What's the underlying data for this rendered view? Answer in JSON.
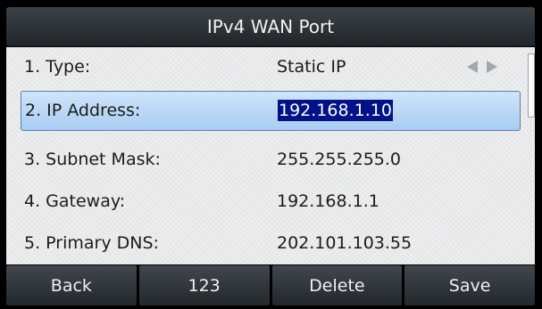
{
  "title": "IPv4 WAN Port",
  "rows": [
    {
      "label": "1. Type:",
      "value": "Static IP"
    },
    {
      "label": "2. IP Address:",
      "value": "192.168.1.10"
    },
    {
      "label": "3. Subnet Mask:",
      "value": "255.255.255.0"
    },
    {
      "label": "4. Gateway:",
      "value": "192.168.1.1"
    },
    {
      "label": "5. Primary DNS:",
      "value": "202.101.103.55"
    }
  ],
  "selected_row": 2,
  "softkeys": [
    "Back",
    "123",
    "Delete",
    "Save"
  ],
  "icons": {
    "prev": "arrow-left-icon",
    "next": "arrow-right-icon"
  },
  "colors": {
    "selection_bg": "#a8cdf2",
    "text_highlight": "#00118a",
    "softkey_bg": "#22272c"
  }
}
